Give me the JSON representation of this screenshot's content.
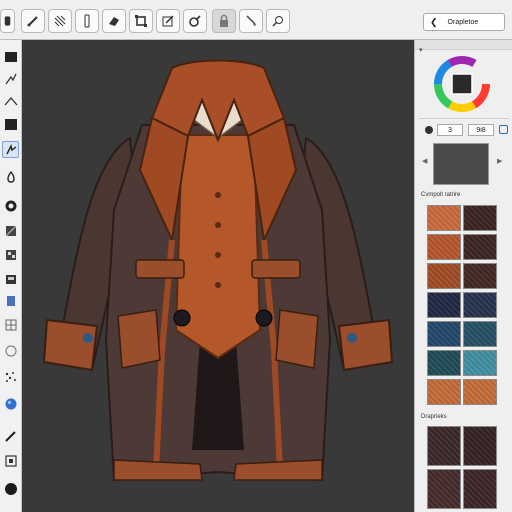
{
  "toolbar": {
    "panel_back_label": "Orapletoe",
    "icons": [
      "pencil-icon",
      "hatch-texture-icon",
      "stamp-icon",
      "eraser-icon",
      "transform-icon",
      "fill-icon",
      "clone-icon",
      "lock-icon",
      "smudge-icon",
      "settings-icon"
    ]
  },
  "tools": [
    "rectangle-select-icon",
    "lasso-icon",
    "line-icon",
    "square-icon",
    "brush-icon",
    "fill-bucket-icon",
    "circle-icon",
    "gradient-icon",
    "layers-icon",
    "crop-icon",
    "grid-icon",
    "ring-icon",
    "scatter-icon",
    "sphere-icon",
    "pen-icon",
    "frame-icon",
    "dot-icon"
  ],
  "panel": {
    "value_a": "3",
    "value_b": "9i8",
    "swatch_section_label": "Cvmpolt ratrire",
    "lower_section_label": "Draprieks",
    "swatch_colors": [
      "#c86a3a",
      "#3a2220",
      "#b5542b",
      "#3b2320",
      "#a14a25",
      "#412620",
      "#1e2742",
      "#25314c",
      "#21466a",
      "#244f64",
      "#1e4a55",
      "#3f8ea0",
      "#c46a37",
      "#c56b38"
    ],
    "lower_swatch_colors": [
      "#3a2626",
      "#332122",
      "#442a2b",
      "#3a2427"
    ]
  },
  "accent_color": "#2c66c9"
}
